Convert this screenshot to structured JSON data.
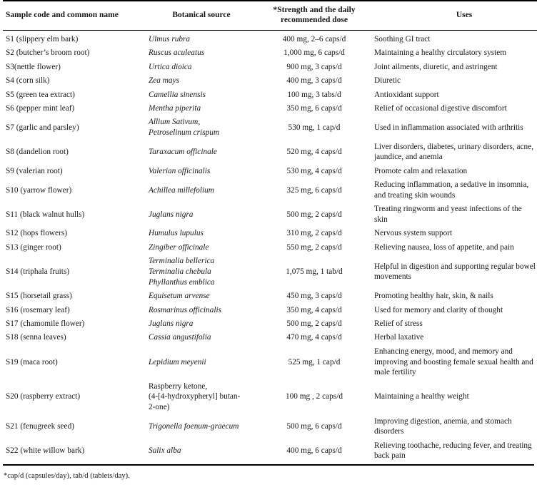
{
  "table": {
    "columns": [
      {
        "key": "sample",
        "label": "Sample code and common name"
      },
      {
        "key": "botanical",
        "label": "Botanical source"
      },
      {
        "key": "dose",
        "label": "*Strength and the daily\nrecommended dose"
      },
      {
        "key": "uses",
        "label": "Uses"
      }
    ],
    "rows": [
      {
        "sample": "S1 (slippery elm bark)",
        "botanical": "Ulmus rubra",
        "botanical_italic": true,
        "dose": "400 mg, 2–6 caps/d",
        "uses": "Soothing GI tract"
      },
      {
        "sample": "S2 (butcher’s broom root)",
        "botanical": "Ruscus aculeatus",
        "botanical_italic": true,
        "dose": "1,000 mg, 6 caps/d",
        "uses": "Maintaining a healthy circulatory system"
      },
      {
        "sample": "S3(nettle flower)",
        "botanical": "Urtica dioica",
        "botanical_italic": true,
        "dose": "900 mg, 3 caps/d",
        "uses": "Joint ailments, diuretic, and astringent"
      },
      {
        "sample": "S4 (corn silk)",
        "botanical": "Zea mays",
        "botanical_italic": true,
        "dose": "400 mg, 3 caps/d",
        "uses": "Diuretic"
      },
      {
        "sample": "S5 (green tea extract)",
        "botanical": "Camellia sinensis",
        "botanical_italic": true,
        "dose": "100 mg, 3 tabs/d",
        "uses": "Antioxidant support"
      },
      {
        "sample": "S6 (pepper mint leaf)",
        "botanical": "Mentha piperita",
        "botanical_italic": true,
        "dose": "350 mg, 6 caps/d",
        "uses": "Relief of occasional digestive discomfort"
      },
      {
        "sample": "S7 (garlic and parsley)",
        "botanical": "Allium Sativum,\nPetroselinum crispum",
        "botanical_italic": true,
        "dose": "530 mg, 1 cap/d",
        "uses": "Used in inflammation associated with arthritis"
      },
      {
        "sample": "S8 (dandelion root)",
        "botanical": "Taraxacum officinale",
        "botanical_italic": true,
        "dose": "520 mg, 4 caps/d",
        "uses": "Liver disorders, diabetes, urinary disorders, acne,\njaundice, and anemia"
      },
      {
        "sample": "S9 (valerian root)",
        "botanical": "Valerian officinalis",
        "botanical_italic": true,
        "dose": "530 mg, 4 caps/d",
        "uses": "Promote calm and relaxation"
      },
      {
        "sample": "S10 (yarrow flower)",
        "botanical": "Achillea millefolium",
        "botanical_italic": true,
        "dose": "325 mg, 6 caps/d",
        "uses": "Reducing inflammation, a sedative in insomnia,\nand treating skin wounds"
      },
      {
        "sample": "S11 (black walnut hulls)",
        "botanical": "Juglans nigra",
        "botanical_italic": true,
        "dose": "500 mg, 2 caps/d",
        "uses": "Treating ringworm and yeast infections of the\nskin"
      },
      {
        "sample": "S12 (hops flowers)",
        "botanical": "Humulus lupulus",
        "botanical_italic": true,
        "dose": "310 mg, 2 caps/d",
        "uses": "Nervous system support"
      },
      {
        "sample": "S13 (ginger root)",
        "botanical": "Zingiber officinale",
        "botanical_italic": true,
        "dose": "550 mg, 2 caps/d",
        "uses": "Relieving nausea, loss of appetite, and pain"
      },
      {
        "sample": "S14 (triphala fruits)",
        "botanical": "Terminalia bellerica\nTerminalia chebula\nPhyllanthus emblica",
        "botanical_italic": true,
        "dose": "1,075 mg, 1 tab/d",
        "uses": "Helpful in digestion and supporting regular bowel\nmovements"
      },
      {
        "sample": "S15 (horsetail grass)",
        "botanical": "Equisetum arvense",
        "botanical_italic": true,
        "dose": "450 mg, 3 caps/d",
        "uses": "Promoting healthy hair, skin, & nails"
      },
      {
        "sample": "S16 (rosemary leaf)",
        "botanical": "Rosmarinus officinalis",
        "botanical_italic": true,
        "dose": "350 mg, 4 caps/d",
        "uses": "Used for memory and clarity of thought"
      },
      {
        "sample": "S17 (chamomile flower)",
        "botanical": "Juglans nigra",
        "botanical_italic": true,
        "dose": "500 mg, 2 caps/d",
        "uses": "Relief of stress"
      },
      {
        "sample": "S18 (senna leaves)",
        "botanical": "Cassia angustifolia",
        "botanical_italic": true,
        "dose": "470 mg, 4 caps/d",
        "uses": "Herbal laxative"
      },
      {
        "sample": "S19 (maca root)",
        "botanical": "Lepidium meyenii",
        "botanical_italic": true,
        "dose": "525 mg, 1 cap/d",
        "uses": "Enhancing energy, mood, and memory and\nimproving and boosting female sexual health and\nmale fertility"
      },
      {
        "sample": "S20 (raspberry extract)",
        "botanical": "Raspberry ketone,\n(4-[4-hydroxypheryl] butan-\n2-one)",
        "botanical_italic": false,
        "dose": "100 mg , 2 caps/d",
        "uses": "Maintaining a healthy weight"
      },
      {
        "sample": "S21 (fenugreek seed)",
        "botanical": "Trigonella foenum-graecum",
        "botanical_italic": true,
        "dose": "500 mg, 6 caps/d",
        "uses": "Improving digestion, anemia, and stomach\ndisorders"
      },
      {
        "sample": "S22 (white willow bark)",
        "botanical": "Salix alba",
        "botanical_italic": true,
        "dose": "400 mg, 6 caps/d",
        "uses": "Relieving toothache, reducing fever, and treating\nback pain"
      }
    ],
    "footnote": "*cap/d (capsules/day), tab/d (tablets/day)."
  }
}
